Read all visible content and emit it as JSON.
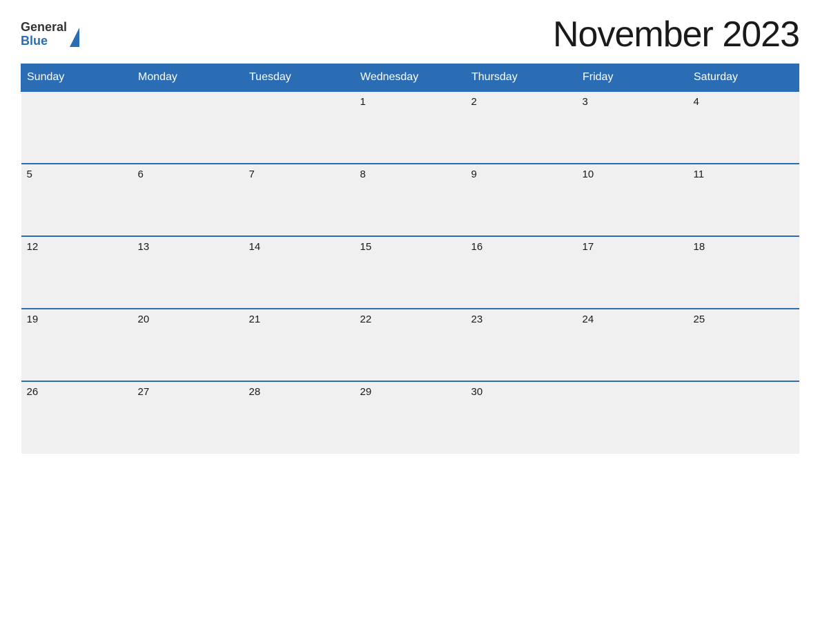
{
  "header": {
    "title": "November 2023",
    "logo_general": "General",
    "logo_blue": "Blue"
  },
  "calendar": {
    "days_of_week": [
      "Sunday",
      "Monday",
      "Tuesday",
      "Wednesday",
      "Thursday",
      "Friday",
      "Saturday"
    ],
    "weeks": [
      [
        {
          "day": "",
          "empty": true
        },
        {
          "day": "",
          "empty": true
        },
        {
          "day": "",
          "empty": true
        },
        {
          "day": "1",
          "empty": false
        },
        {
          "day": "2",
          "empty": false
        },
        {
          "day": "3",
          "empty": false
        },
        {
          "day": "4",
          "empty": false
        }
      ],
      [
        {
          "day": "5",
          "empty": false
        },
        {
          "day": "6",
          "empty": false
        },
        {
          "day": "7",
          "empty": false
        },
        {
          "day": "8",
          "empty": false
        },
        {
          "day": "9",
          "empty": false
        },
        {
          "day": "10",
          "empty": false
        },
        {
          "day": "11",
          "empty": false
        }
      ],
      [
        {
          "day": "12",
          "empty": false
        },
        {
          "day": "13",
          "empty": false
        },
        {
          "day": "14",
          "empty": false
        },
        {
          "day": "15",
          "empty": false
        },
        {
          "day": "16",
          "empty": false
        },
        {
          "day": "17",
          "empty": false
        },
        {
          "day": "18",
          "empty": false
        }
      ],
      [
        {
          "day": "19",
          "empty": false
        },
        {
          "day": "20",
          "empty": false
        },
        {
          "day": "21",
          "empty": false
        },
        {
          "day": "22",
          "empty": false
        },
        {
          "day": "23",
          "empty": false
        },
        {
          "day": "24",
          "empty": false
        },
        {
          "day": "25",
          "empty": false
        }
      ],
      [
        {
          "day": "26",
          "empty": false
        },
        {
          "day": "27",
          "empty": false
        },
        {
          "day": "28",
          "empty": false
        },
        {
          "day": "29",
          "empty": false
        },
        {
          "day": "30",
          "empty": false
        },
        {
          "day": "",
          "empty": true
        },
        {
          "day": "",
          "empty": true
        }
      ]
    ]
  }
}
